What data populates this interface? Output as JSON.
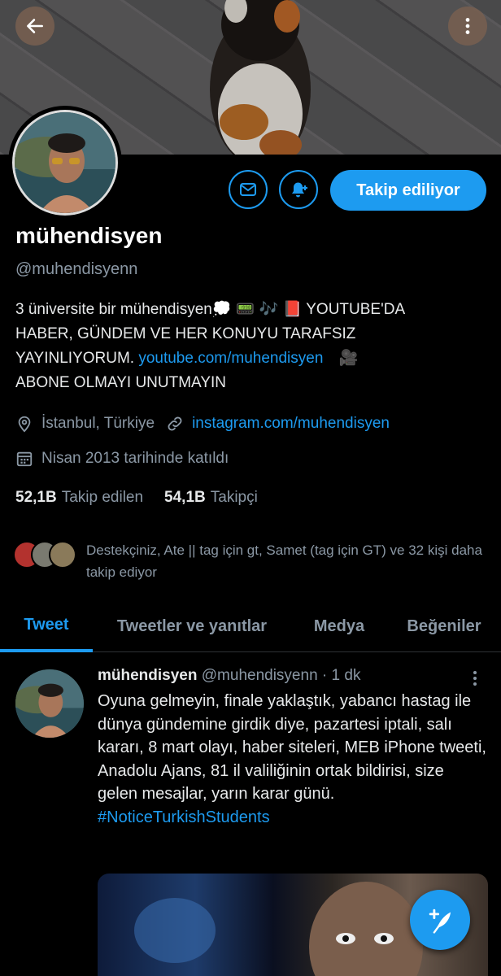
{
  "header": {
    "back_icon": "arrow-left-icon",
    "more_icon": "more-vertical-icon"
  },
  "profile": {
    "name": "mühendisyen",
    "handle": "@muhendisyenn",
    "bio_line1": "3 üniversite bir mühendisyen💭 📟 🎶 📕 YOUTUBE'DA",
    "bio_line2": "HABER, GÜNDEM VE HER KONUYU TARAFSIZ",
    "bio_line3_text": "YAYINLIYORUM. ",
    "bio_link": "youtube.com/muhendisyen",
    "bio_line3_emoji": "🎥",
    "bio_line4": "ABONE OLMAYI UNUTMAYIN",
    "location": "İstanbul, Türkiye",
    "website": "instagram.com/muhendisyen",
    "joined": "Nisan 2013 tarihinde katıldı",
    "following_count": "52,1B",
    "following_label": "Takip edilen",
    "followers_count": "54,1B",
    "followers_label": "Takipçi",
    "followed_by_text": "Destekçiniz, Ate || tag için gt, Samet (tag için GT) ve 32 kişi daha takip ediyor"
  },
  "actions": {
    "message_icon": "envelope-icon",
    "notify_icon": "bell-plus-icon",
    "follow_label": "Takip ediliyor"
  },
  "tabs": [
    {
      "label": "Tweet"
    },
    {
      "label": "Tweetler ve yanıtlar"
    },
    {
      "label": "Medya"
    },
    {
      "label": "Beğeniler"
    }
  ],
  "tweet": {
    "author": "mühendisyen",
    "handle": "@muhendisyenn",
    "time": "· 1 dk",
    "text": "Oyuna gelmeyin, finale yaklaştık, yabancı hastag ile dünya gündemine girdik diye, pazartesi iptali, salı kararı, 8 mart olayı, haber siteleri, MEB iPhone tweeti, Anadolu Ajans, 81 il valiliğinin ortak bildirisi, size gelen mesajlar, yarın karar günü.",
    "hashtag": "#NoticeTurkishStudents"
  },
  "colors": {
    "accent": "#1d9bf0",
    "secondary_text": "#8b98a5",
    "background": "#000000"
  }
}
